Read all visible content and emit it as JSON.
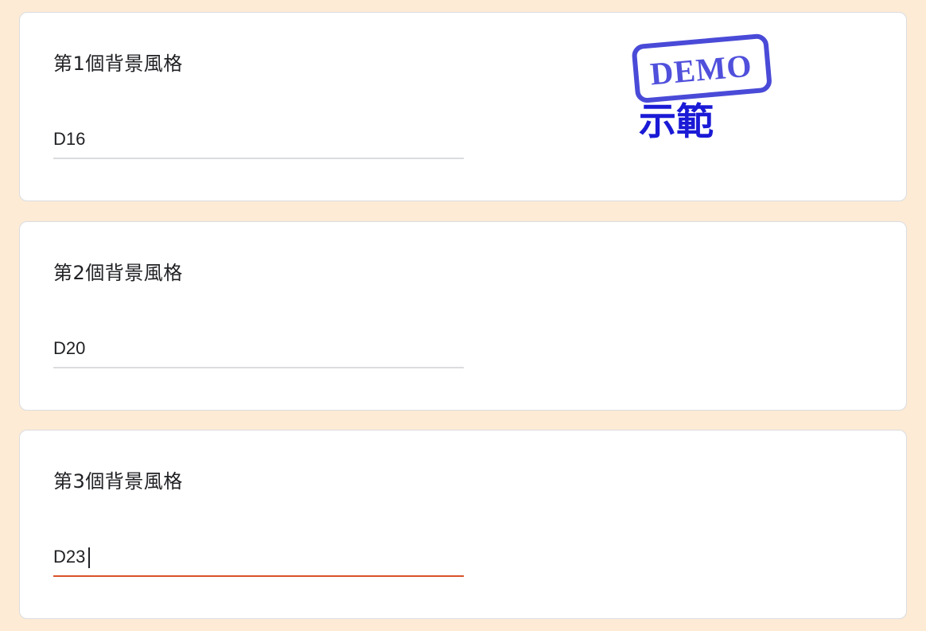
{
  "questions": [
    {
      "title": "第1個背景風格",
      "answer": "D16",
      "active": false
    },
    {
      "title": "第2個背景風格",
      "answer": "D20",
      "active": false
    },
    {
      "title": "第3個背景風格",
      "answer": "D23",
      "active": true
    }
  ],
  "stamp": {
    "text": "DEMO",
    "subtitle": "示範"
  },
  "colors": {
    "page_background": "#fdebd6",
    "card_border": "#dadce0",
    "active_underline": "#d9532b",
    "stamp_ink": "#4a4ad8",
    "stamp_subtitle": "#1a1ad6"
  }
}
